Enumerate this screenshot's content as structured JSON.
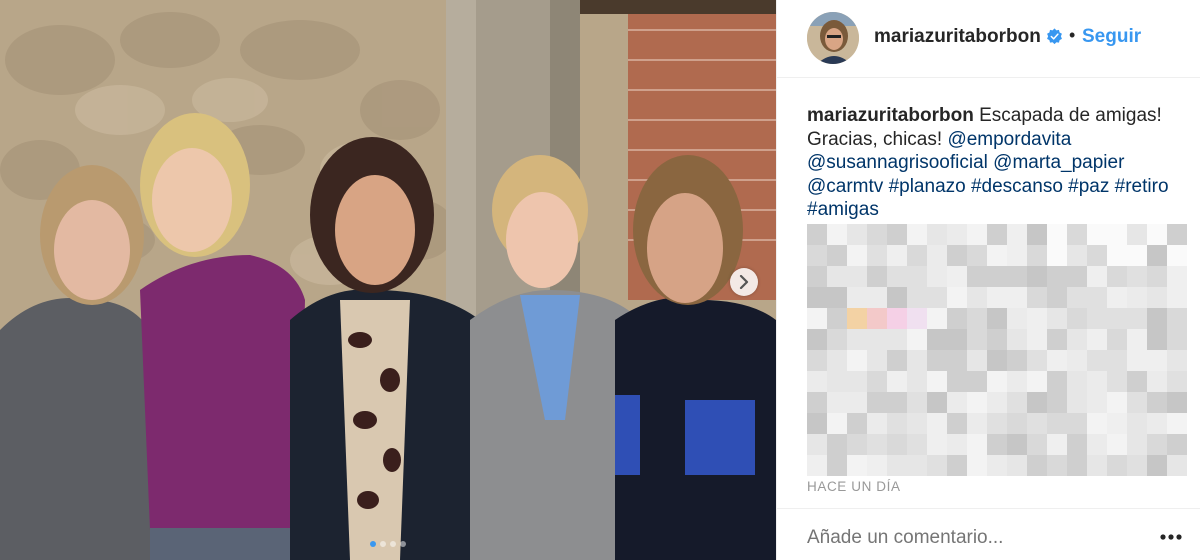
{
  "post": {
    "username": "mariazuritaborbon",
    "verified": true,
    "separator": "•",
    "follow_label": "Seguir",
    "caption": {
      "username": "mariazuritaborbon",
      "text_parts": [
        {
          "text": " Escapada de amigas! Gracias, chicas! ",
          "type": "text"
        },
        {
          "text": "@empordavita",
          "type": "tag"
        },
        {
          "text": " ",
          "type": "text"
        },
        {
          "text": "@susannagrisooficial",
          "type": "tag"
        },
        {
          "text": " ",
          "type": "text"
        },
        {
          "text": "@marta_papier",
          "type": "tag"
        },
        {
          "text": " ",
          "type": "text"
        },
        {
          "text": "@carmtv",
          "type": "tag"
        },
        {
          "text": " ",
          "type": "text"
        },
        {
          "text": "#planazo",
          "type": "tag"
        },
        {
          "text": " ",
          "type": "text"
        },
        {
          "text": "#descanso",
          "type": "tag"
        },
        {
          "text": " ",
          "type": "text"
        },
        {
          "text": "#paz",
          "type": "tag"
        },
        {
          "text": " ",
          "type": "text"
        },
        {
          "text": "#retiro",
          "type": "tag"
        },
        {
          "text": " ",
          "type": "text"
        },
        {
          "text": "#amigas",
          "type": "tag"
        }
      ]
    },
    "timestamp": "HACE UN DÍA",
    "comment_placeholder": "Añade un comentario...",
    "carousel": {
      "count": 4,
      "active_index": 0
    }
  },
  "icons": {
    "verified": "verified-badge-icon",
    "next": "chevron-right-icon",
    "more": "more-options-icon"
  },
  "colors": {
    "link": "#003569",
    "accent": "#3897f0",
    "muted": "#999999",
    "text": "#262626"
  }
}
